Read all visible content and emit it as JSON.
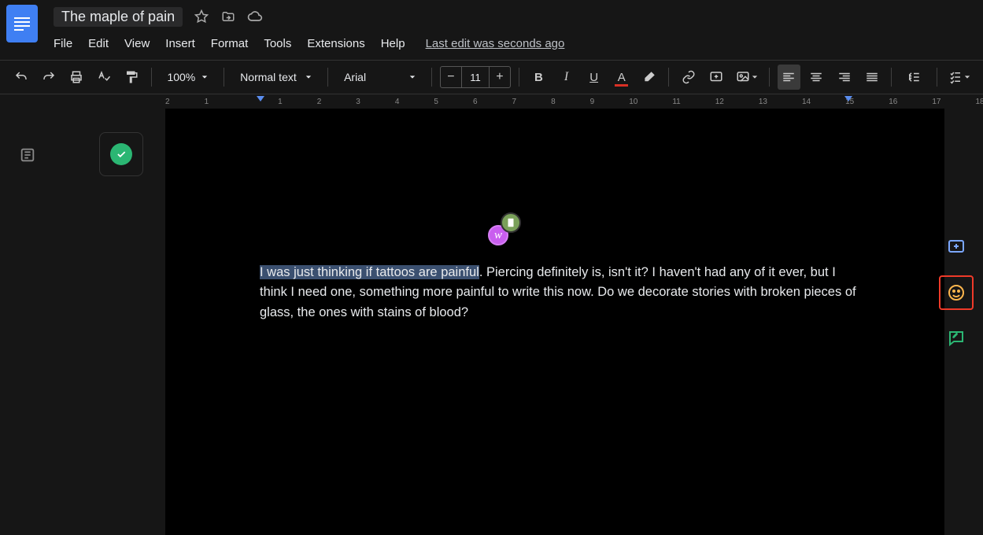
{
  "doc": {
    "title": "The maple of pain"
  },
  "menus": {
    "file": "File",
    "edit": "Edit",
    "view": "View",
    "insert": "Insert",
    "format": "Format",
    "tools": "Tools",
    "extensions": "Extensions",
    "help": "Help",
    "last_edit": "Last edit was seconds ago"
  },
  "toolbar": {
    "zoom": "100%",
    "style": "Normal text",
    "font": "Arial",
    "font_size": "11"
  },
  "ruler": {
    "ticks": [
      "2",
      "1",
      "",
      "1",
      "2",
      "3",
      "4",
      "5",
      "6",
      "7",
      "8",
      "9",
      "10",
      "11",
      "12",
      "13",
      "14",
      "15",
      "16",
      "17",
      "18"
    ]
  },
  "body": {
    "selected": "I was just thinking if tattoos are painful",
    "rest": ". Piercing definitely is, isn't it? I haven't had any of it ever, but I think I need one, something more painful to write this now. Do we decorate stories with broken pieces of glass, the ones with stains of blood?"
  },
  "avatars": {
    "w": "w"
  }
}
